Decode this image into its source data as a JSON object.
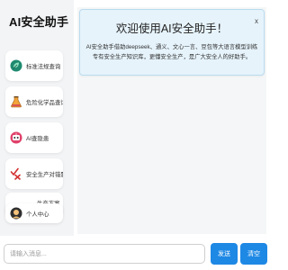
{
  "sidebar": {
    "brand": "AI安全助手",
    "items": [
      {
        "label": "标准法规查询",
        "icon": "leaf-icon"
      },
      {
        "label": "危险化学品查询",
        "icon": "hazard-flask-icon"
      },
      {
        "label": "AI查隐患",
        "icon": "robot-icon"
      },
      {
        "label": "安全生产对错题",
        "icon": "check-cross-icon"
      },
      {
        "label": "生产方案",
        "icon": "document-icon"
      },
      {
        "label": "个人中心",
        "icon": "user-avatar-icon"
      }
    ]
  },
  "main": {
    "close_label": "x",
    "welcome_title": "欢迎使用AI安全助手！",
    "welcome_desc": "AI安全助手借助deepseek、通义、文心一言、豆包等大语言模型训练专有安全生产知识库，更懂安全生产，是广大安全人的好助手。"
  },
  "input_bar": {
    "placeholder": "请输入消息...",
    "value": "",
    "send_label": "发送",
    "clear_label": "清空"
  },
  "colors": {
    "accent": "#1e88e5",
    "welcome_bg": "#e6f3fb",
    "sidebar_bg": "#f3f4f6"
  }
}
